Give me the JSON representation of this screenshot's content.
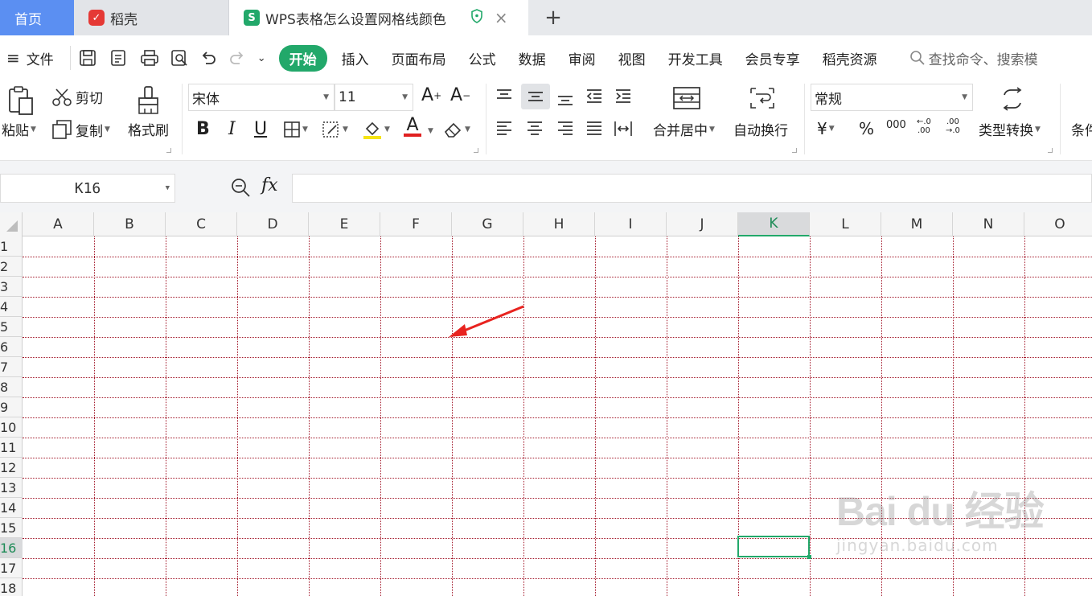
{
  "tabs": {
    "home": "首页",
    "daoke": "稻壳",
    "doc": "WPS表格怎么设置网格线颜色",
    "doc_icon": "S"
  },
  "menubar": {
    "file": "文件",
    "items": [
      "开始",
      "插入",
      "页面布局",
      "公式",
      "数据",
      "审阅",
      "视图",
      "开发工具",
      "会员专享",
      "稻壳资源"
    ],
    "search_placeholder": "查找命令、搜索模"
  },
  "ribbon": {
    "paste": "粘贴",
    "cut": "剪切",
    "copy": "复制",
    "format_painter": "格式刷",
    "font_name": "宋体",
    "font_size": "11",
    "merge_center": "合并居中",
    "wrap_text": "自动换行",
    "number_format": "常规",
    "type_convert": "类型转换",
    "conditional": "条件",
    "currency_symbol": "¥",
    "percent_symbol": "%",
    "thousands_symbol": "000"
  },
  "formula_bar": {
    "cell_ref": "K16",
    "fx": "fx",
    "value": ""
  },
  "sheet": {
    "columns": [
      "A",
      "B",
      "C",
      "D",
      "E",
      "F",
      "G",
      "H",
      "I",
      "J",
      "K",
      "L",
      "M",
      "N",
      "O"
    ],
    "rows": [
      "1",
      "2",
      "3",
      "4",
      "5",
      "6",
      "7",
      "8",
      "9",
      "10",
      "11",
      "12",
      "13",
      "14",
      "15",
      "16",
      "17",
      "18"
    ],
    "active_col": "K",
    "active_row": "16",
    "gridline_color": "#a3182a",
    "accent": "#22a86a"
  },
  "watermark": {
    "logo": "Bai du 经验",
    "url": "jingyan.baidu.com"
  }
}
